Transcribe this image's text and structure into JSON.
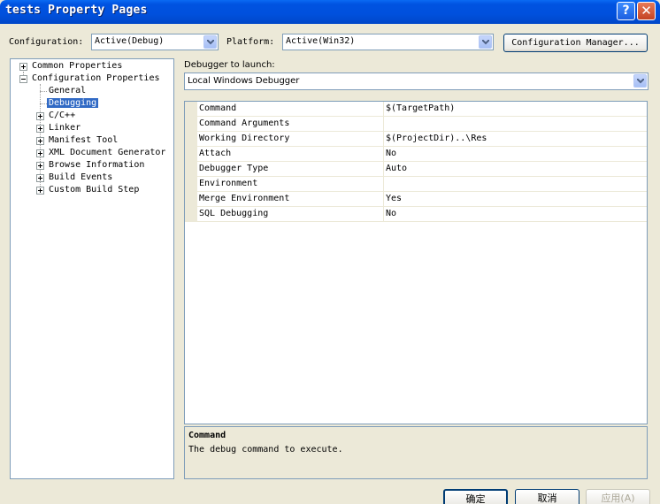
{
  "window": {
    "title": "tests Property Pages"
  },
  "toolbar": {
    "configuration_label": "Configuration:",
    "configuration_value": "Active(Debug)",
    "platform_label": "Platform:",
    "platform_value": "Active(Win32)",
    "config_manager_label": "Configuration Manager..."
  },
  "tree": {
    "common_properties": "Common Properties",
    "configuration_properties": "Configuration Properties",
    "general": "General",
    "debugging": "Debugging",
    "c_cpp": "C/C++",
    "linker": "Linker",
    "manifest_tool": "Manifest Tool",
    "xml_doc_gen": "XML Document Generator",
    "browse_info": "Browse Information",
    "build_events": "Build Events",
    "custom_build_step": "Custom Build Step"
  },
  "debugger": {
    "label": "Debugger to launch:",
    "value": "Local Windows Debugger"
  },
  "properties": [
    {
      "name": "Command",
      "value": "$(TargetPath)"
    },
    {
      "name": "Command Arguments",
      "value": ""
    },
    {
      "name": "Working Directory",
      "value": "$(ProjectDir)..\\Res"
    },
    {
      "name": "Attach",
      "value": "No"
    },
    {
      "name": "Debugger Type",
      "value": "Auto"
    },
    {
      "name": "Environment",
      "value": ""
    },
    {
      "name": "Merge Environment",
      "value": "Yes"
    },
    {
      "name": "SQL Debugging",
      "value": "No"
    }
  ],
  "description": {
    "title": "Command",
    "text": "The debug command to execute."
  },
  "buttons": {
    "ok": "确定",
    "cancel": "取消",
    "apply": "应用(A)"
  }
}
